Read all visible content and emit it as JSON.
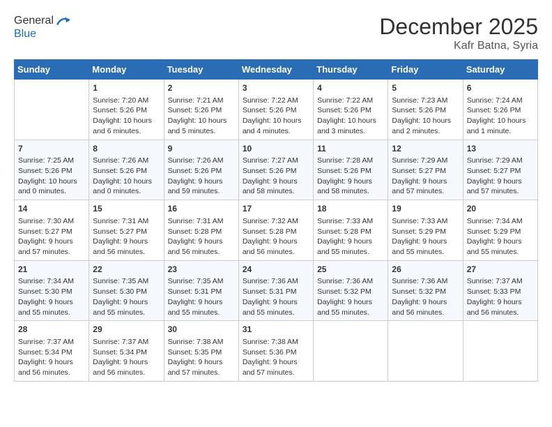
{
  "header": {
    "logo_line1": "General",
    "logo_line2": "Blue",
    "month_year": "December 2025",
    "location": "Kafr Batna, Syria"
  },
  "calendar": {
    "days_of_week": [
      "Sunday",
      "Monday",
      "Tuesday",
      "Wednesday",
      "Thursday",
      "Friday",
      "Saturday"
    ],
    "weeks": [
      [
        {
          "day": "",
          "info": ""
        },
        {
          "day": "1",
          "info": "Sunrise: 7:20 AM\nSunset: 5:26 PM\nDaylight: 10 hours\nand 6 minutes."
        },
        {
          "day": "2",
          "info": "Sunrise: 7:21 AM\nSunset: 5:26 PM\nDaylight: 10 hours\nand 5 minutes."
        },
        {
          "day": "3",
          "info": "Sunrise: 7:22 AM\nSunset: 5:26 PM\nDaylight: 10 hours\nand 4 minutes."
        },
        {
          "day": "4",
          "info": "Sunrise: 7:22 AM\nSunset: 5:26 PM\nDaylight: 10 hours\nand 3 minutes."
        },
        {
          "day": "5",
          "info": "Sunrise: 7:23 AM\nSunset: 5:26 PM\nDaylight: 10 hours\nand 2 minutes."
        },
        {
          "day": "6",
          "info": "Sunrise: 7:24 AM\nSunset: 5:26 PM\nDaylight: 10 hours\nand 1 minute."
        }
      ],
      [
        {
          "day": "7",
          "info": "Sunrise: 7:25 AM\nSunset: 5:26 PM\nDaylight: 10 hours\nand 0 minutes."
        },
        {
          "day": "8",
          "info": "Sunrise: 7:26 AM\nSunset: 5:26 PM\nDaylight: 10 hours\nand 0 minutes."
        },
        {
          "day": "9",
          "info": "Sunrise: 7:26 AM\nSunset: 5:26 PM\nDaylight: 9 hours\nand 59 minutes."
        },
        {
          "day": "10",
          "info": "Sunrise: 7:27 AM\nSunset: 5:26 PM\nDaylight: 9 hours\nand 58 minutes."
        },
        {
          "day": "11",
          "info": "Sunrise: 7:28 AM\nSunset: 5:26 PM\nDaylight: 9 hours\nand 58 minutes."
        },
        {
          "day": "12",
          "info": "Sunrise: 7:29 AM\nSunset: 5:27 PM\nDaylight: 9 hours\nand 57 minutes."
        },
        {
          "day": "13",
          "info": "Sunrise: 7:29 AM\nSunset: 5:27 PM\nDaylight: 9 hours\nand 57 minutes."
        }
      ],
      [
        {
          "day": "14",
          "info": "Sunrise: 7:30 AM\nSunset: 5:27 PM\nDaylight: 9 hours\nand 57 minutes."
        },
        {
          "day": "15",
          "info": "Sunrise: 7:31 AM\nSunset: 5:27 PM\nDaylight: 9 hours\nand 56 minutes."
        },
        {
          "day": "16",
          "info": "Sunrise: 7:31 AM\nSunset: 5:28 PM\nDaylight: 9 hours\nand 56 minutes."
        },
        {
          "day": "17",
          "info": "Sunrise: 7:32 AM\nSunset: 5:28 PM\nDaylight: 9 hours\nand 56 minutes."
        },
        {
          "day": "18",
          "info": "Sunrise: 7:33 AM\nSunset: 5:28 PM\nDaylight: 9 hours\nand 55 minutes."
        },
        {
          "day": "19",
          "info": "Sunrise: 7:33 AM\nSunset: 5:29 PM\nDaylight: 9 hours\nand 55 minutes."
        },
        {
          "day": "20",
          "info": "Sunrise: 7:34 AM\nSunset: 5:29 PM\nDaylight: 9 hours\nand 55 minutes."
        }
      ],
      [
        {
          "day": "21",
          "info": "Sunrise: 7:34 AM\nSunset: 5:30 PM\nDaylight: 9 hours\nand 55 minutes."
        },
        {
          "day": "22",
          "info": "Sunrise: 7:35 AM\nSunset: 5:30 PM\nDaylight: 9 hours\nand 55 minutes."
        },
        {
          "day": "23",
          "info": "Sunrise: 7:35 AM\nSunset: 5:31 PM\nDaylight: 9 hours\nand 55 minutes."
        },
        {
          "day": "24",
          "info": "Sunrise: 7:36 AM\nSunset: 5:31 PM\nDaylight: 9 hours\nand 55 minutes."
        },
        {
          "day": "25",
          "info": "Sunrise: 7:36 AM\nSunset: 5:32 PM\nDaylight: 9 hours\nand 55 minutes."
        },
        {
          "day": "26",
          "info": "Sunrise: 7:36 AM\nSunset: 5:32 PM\nDaylight: 9 hours\nand 56 minutes."
        },
        {
          "day": "27",
          "info": "Sunrise: 7:37 AM\nSunset: 5:33 PM\nDaylight: 9 hours\nand 56 minutes."
        }
      ],
      [
        {
          "day": "28",
          "info": "Sunrise: 7:37 AM\nSunset: 5:34 PM\nDaylight: 9 hours\nand 56 minutes."
        },
        {
          "day": "29",
          "info": "Sunrise: 7:37 AM\nSunset: 5:34 PM\nDaylight: 9 hours\nand 56 minutes."
        },
        {
          "day": "30",
          "info": "Sunrise: 7:38 AM\nSunset: 5:35 PM\nDaylight: 9 hours\nand 57 minutes."
        },
        {
          "day": "31",
          "info": "Sunrise: 7:38 AM\nSunset: 5:36 PM\nDaylight: 9 hours\nand 57 minutes."
        },
        {
          "day": "",
          "info": ""
        },
        {
          "day": "",
          "info": ""
        },
        {
          "day": "",
          "info": ""
        }
      ]
    ]
  }
}
